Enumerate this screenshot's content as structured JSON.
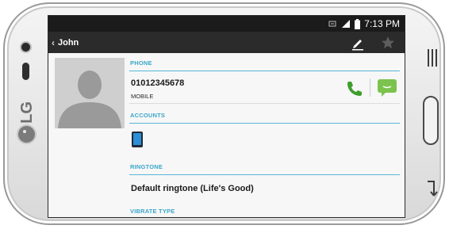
{
  "device": {
    "brand": "LG"
  },
  "status_bar": {
    "time": "7:13 PM"
  },
  "action_bar": {
    "back_chevron": "‹",
    "contact_name": "John",
    "edit_icon": "pencil-icon",
    "favorite_icon": "star-icon"
  },
  "contact": {
    "photo_icon": "contact-placeholder-icon",
    "sections": {
      "phone": {
        "label": "PHONE",
        "number": "01012345678",
        "type": "MOBILE"
      },
      "accounts": {
        "label": "ACCOUNTS",
        "icon": "phone-account-icon"
      },
      "ringtone": {
        "label": "RINGTONE",
        "value": "Default ringtone (Life's Good)"
      },
      "vibrate": {
        "label": "VIBRATE TYPE"
      }
    }
  },
  "colors": {
    "accent": "#3aa6c9",
    "call_green": "#3e9e2c",
    "message_green": "#7cc34e"
  }
}
